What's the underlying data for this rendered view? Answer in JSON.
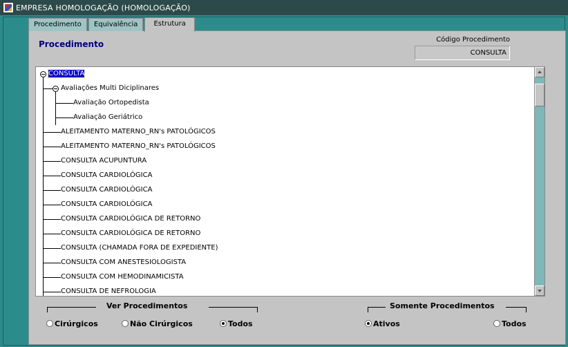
{
  "window": {
    "title": "EMPRESA HOMOLOGAÇÃO (HOMOLOGAÇÃO)",
    "icon": "app-icon"
  },
  "tabs": [
    {
      "label": "Procedimento",
      "active": false
    },
    {
      "label": "Equivalência",
      "active": false
    },
    {
      "label": "Estrutura",
      "active": true
    }
  ],
  "section": {
    "title": "Procedimento"
  },
  "code": {
    "label": "Código Procedimento",
    "value": "CONSULTA"
  },
  "tree": {
    "root": "CONSULTA",
    "group": "Avaliações Multi Diciplinares",
    "group_children": [
      "Avaliação Ortopedista",
      "Avaliação Geriátrico"
    ],
    "items": [
      "ALEITAMENTO MATERNO_RN's PATOLÓGICOS",
      "ALEITAMENTO MATERNO_RN's PATOLÓGICOS",
      "CONSULTA ACUPUNTURA",
      "CONSULTA CARDIOLÓGICA",
      "CONSULTA CARDIOLÓGICA",
      "CONSULTA CARDIOLÓGICA",
      "CONSULTA CARDIOLÓGICA DE RETORNO",
      "CONSULTA CARDIOLÓGICA DE RETORNO",
      "CONSULTA (CHAMADA FORA DE EXPEDIENTE)",
      "CONSULTA COM ANESTESIOLOGISTA",
      "CONSULTA COM HEMODINAMICISTA",
      "CONSULTA DE  NEFROLOGIA"
    ]
  },
  "ver": {
    "legend": "Ver Procedimentos",
    "options": [
      {
        "label": "Cirúrgicos",
        "checked": false
      },
      {
        "label": "Não Cirúrgicos",
        "checked": false
      },
      {
        "label": "Todos",
        "checked": true
      }
    ]
  },
  "somente": {
    "legend": "Somente  Procedimentos",
    "options": [
      {
        "label": "Ativos",
        "checked": true
      },
      {
        "label": "Todos",
        "checked": false
      }
    ]
  }
}
